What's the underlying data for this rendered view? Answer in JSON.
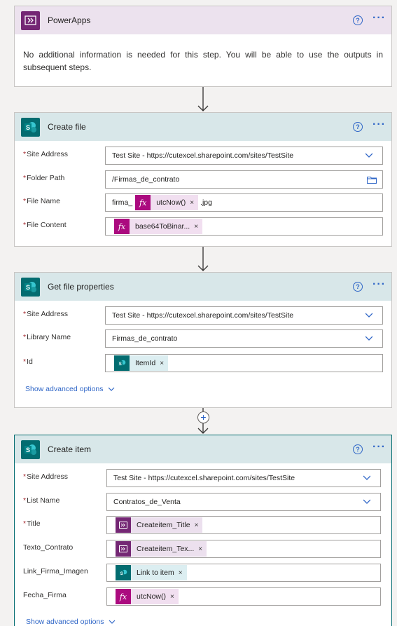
{
  "colors": {
    "powerapps": "#742774",
    "sharepoint": "#036c70",
    "expression": "#ab0a7f",
    "link": "#2f66c7"
  },
  "steps": {
    "powerapps": {
      "title": "PowerApps",
      "info": "No additional information is needed for this step. You will be able to use the outputs in subsequent steps."
    },
    "create_file": {
      "title": "Create file",
      "site_address": {
        "label": "Site Address",
        "value": "Test Site - https://cutexcel.sharepoint.com/sites/TestSite"
      },
      "folder_path": {
        "label": "Folder Path",
        "value": "/Firmas_de_contrato"
      },
      "file_name": {
        "label": "File Name",
        "prefix": "firma_",
        "token": "utcNow()",
        "suffix": ".jpg"
      },
      "file_content": {
        "label": "File Content",
        "token": "base64ToBinar..."
      }
    },
    "get_file_properties": {
      "title": "Get file properties",
      "site_address": {
        "label": "Site Address",
        "value": "Test Site - https://cutexcel.sharepoint.com/sites/TestSite"
      },
      "library_name": {
        "label": "Library Name",
        "value": "Firmas_de_contrato"
      },
      "id": {
        "label": "Id",
        "token": "ItemId"
      },
      "advanced": "Show advanced options"
    },
    "create_item": {
      "title": "Create item",
      "site_address": {
        "label": "Site Address",
        "value": "Test Site - https://cutexcel.sharepoint.com/sites/TestSite"
      },
      "list_name": {
        "label": "List Name",
        "value": "Contratos_de_Venta"
      },
      "title_field": {
        "label": "Title",
        "token": "Createitem_Title"
      },
      "texto_contrato": {
        "label": "Texto_Contrato",
        "token": "Createitem_Tex..."
      },
      "link_firma": {
        "label": "Link_Firma_Imagen",
        "token": "Link to item"
      },
      "fecha_firma": {
        "label": "Fecha_Firma",
        "token": "utcNow()"
      },
      "advanced": "Show advanced options"
    }
  },
  "icons": {
    "help": "?",
    "more": "···",
    "remove": "×",
    "expression": "fx",
    "add": "+"
  }
}
